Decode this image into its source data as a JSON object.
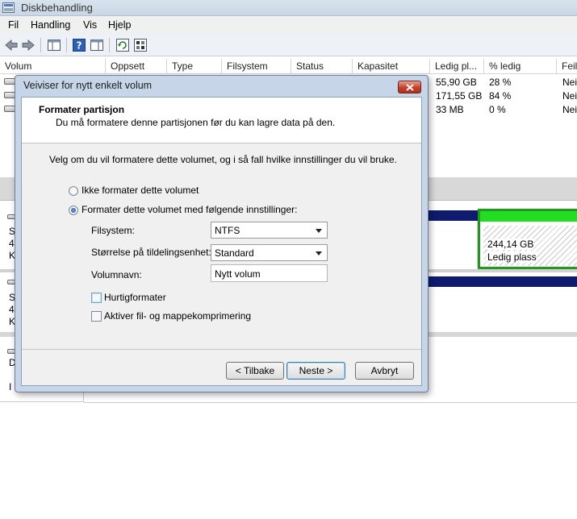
{
  "window": {
    "title": "Diskbehandling"
  },
  "menu": {
    "items": [
      "Fil",
      "Handling",
      "Vis",
      "Hjelp"
    ]
  },
  "toolbar": {
    "icons": [
      "back-arrow-icon",
      "forward-arrow-icon",
      "console-tree-icon",
      "help-icon",
      "action-pane-icon",
      "refresh-icon",
      "properties-icon"
    ]
  },
  "volume_list": {
    "columns": [
      "Volum",
      "Oppsett",
      "Type",
      "Filsystem",
      "Status",
      "Kapasitet",
      "Ledig pl...",
      "% ledig",
      "Feil"
    ],
    "rows": [
      {
        "free": "55,90 GB",
        "pct": "28 %",
        "fault": "Nei"
      },
      {
        "free": "171,55 GB",
        "pct": "84 %",
        "fault": "Nei"
      },
      {
        "free": "33 MB",
        "pct": "0 %",
        "fault": "Nei"
      }
    ]
  },
  "disk_map": {
    "unallocated_size": "244,14 GB",
    "unallocated_label": "Ledig plass",
    "left_stubs": [
      "S",
      "4",
      "K",
      "S",
      "4",
      "K",
      "D",
      "I"
    ]
  },
  "dialog": {
    "title": "Veiviser for nytt enkelt volum",
    "header_title": "Formater partisjon",
    "header_subtitle": "Du må formatere denne partisjonen før du kan lagre data på den.",
    "intro": "Velg om du vil formatere dette volumet, og i så fall hvilke innstillinger du vil bruke.",
    "option_no_format": "Ikke formater dette volumet",
    "option_format": "Formater dette volumet med følgende innstillinger:",
    "filesystem_label": "Filsystem:",
    "filesystem_value": "NTFS",
    "alloc_label": "Størrelse på tildelingsenhet:",
    "alloc_value": "Standard",
    "volname_label": "Volumnavn:",
    "volname_value": "Nytt volum",
    "quick_format": "Hurtigformater",
    "compression": "Aktiver fil- og mappekomprimering",
    "btn_back": "< Tilbake",
    "btn_next": "Neste >",
    "btn_cancel": "Avbryt"
  },
  "colors": {
    "primary_band": "#0e1b6e",
    "unallocated_border": "#1f9a1f",
    "unallocated_top": "#22dd22"
  }
}
